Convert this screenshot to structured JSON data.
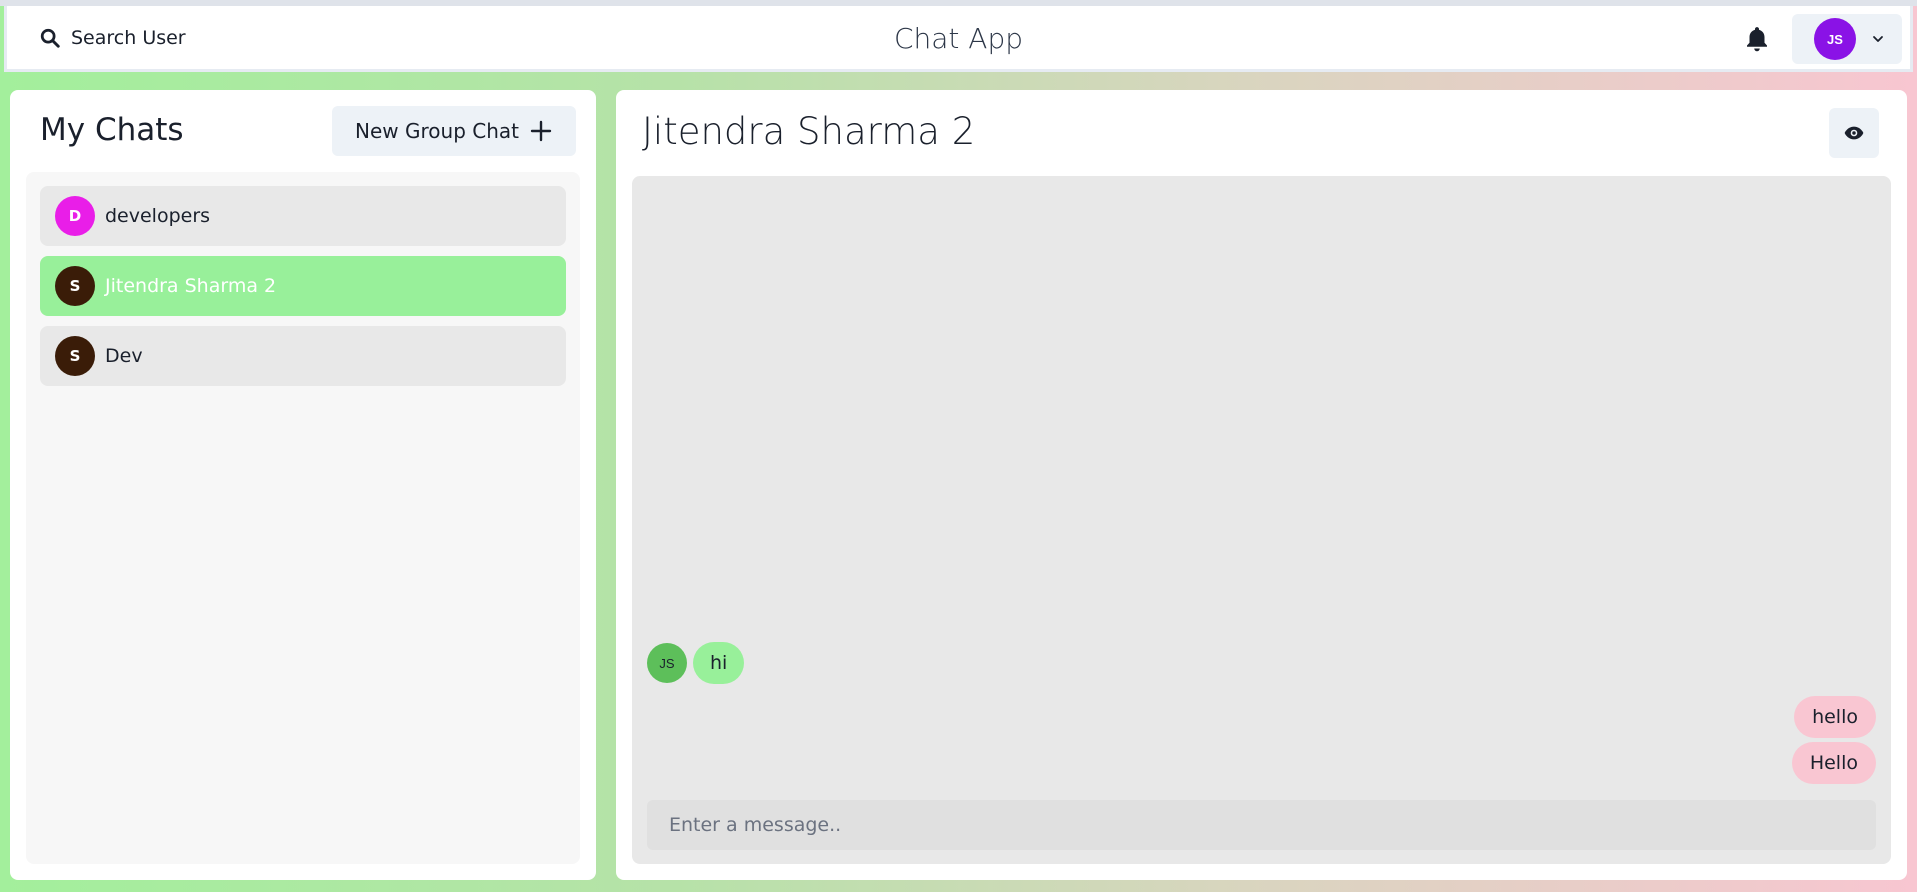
{
  "header": {
    "search_label": "Search User",
    "app_title": "Chat App",
    "profile_initials": "JS"
  },
  "sidebar": {
    "title": "My Chats",
    "new_group_label": "New Group Chat",
    "chats": [
      {
        "name": "developers",
        "avatar": "D",
        "avatar_color": "#e91ee8",
        "active": false
      },
      {
        "name": "Jitendra Sharma 2",
        "avatar": "S",
        "avatar_color": "#3a1c08",
        "active": true
      },
      {
        "name": "Dev",
        "avatar": "S",
        "avatar_color": "#3a1c08",
        "active": false
      }
    ]
  },
  "conversation": {
    "title": "Jitendra Sharma 2",
    "messages": [
      {
        "text": "hi",
        "from": "other",
        "avatar": "JS"
      },
      {
        "text": "hello",
        "from": "me"
      },
      {
        "text": "Hello",
        "from": "me"
      }
    ],
    "input_placeholder": "Enter a message.."
  },
  "colors": {
    "active_chat": "#98f09a",
    "my_bubble": "#f9c6d2",
    "their_bubble": "#98f09a",
    "profile_avatar": "#8a12e6"
  }
}
